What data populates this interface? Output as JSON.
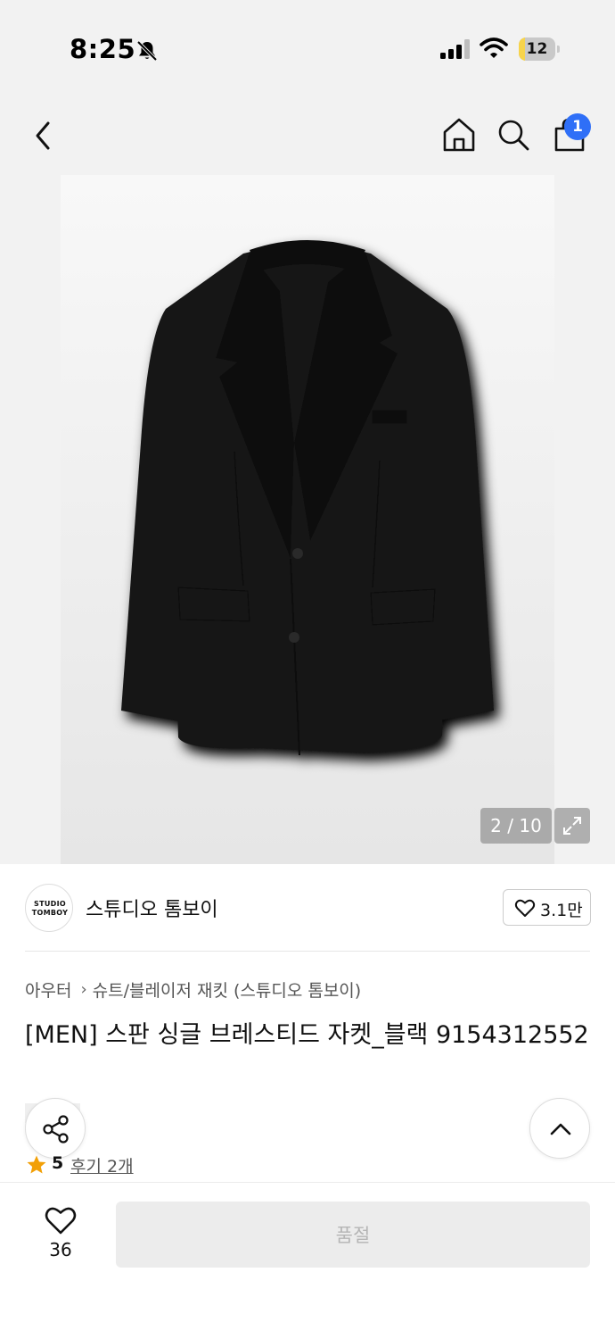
{
  "status_bar": {
    "time": "8:25",
    "battery_level": "12",
    "battery_fraction": 0.12,
    "icons": [
      "bell-slash-icon",
      "cellular-signal-icon",
      "wifi-icon",
      "battery-icon"
    ]
  },
  "nav": {
    "icons": [
      "back-icon",
      "home-icon",
      "search-icon",
      "shopping-bag-icon"
    ],
    "cart_badge": "1"
  },
  "gallery": {
    "counter": "2 / 10",
    "expand_icon": "expand-icon"
  },
  "brand": {
    "logo_line1": "STUDIO",
    "logo_line2": "TOMBOY",
    "name": "스튜디오 톰보이",
    "likes": "3.1만",
    "like_icon": "heart-outline-icon"
  },
  "breadcrumb": {
    "category": "아우터",
    "subcategory": "슈트/블레이저 재킷 (스튜디오 톰보이)",
    "separator_icon": "chevron-right-icon"
  },
  "product": {
    "title": "[MEN] 스판 싱글 브레스티드 자켓_블랙 9154312552"
  },
  "rating": {
    "score": "5",
    "review_link": "후기 2개",
    "star_color": "#f2a007"
  },
  "floating": {
    "share_icon": "share-icon",
    "scroll_top_icon": "chevron-up-icon"
  },
  "bottom_bar": {
    "wish_count": "36",
    "sold_out_label": "품절"
  },
  "colors": {
    "badge": "#2f6ff7",
    "battery": "#f7d44c",
    "disabled_button": "#ececec"
  }
}
